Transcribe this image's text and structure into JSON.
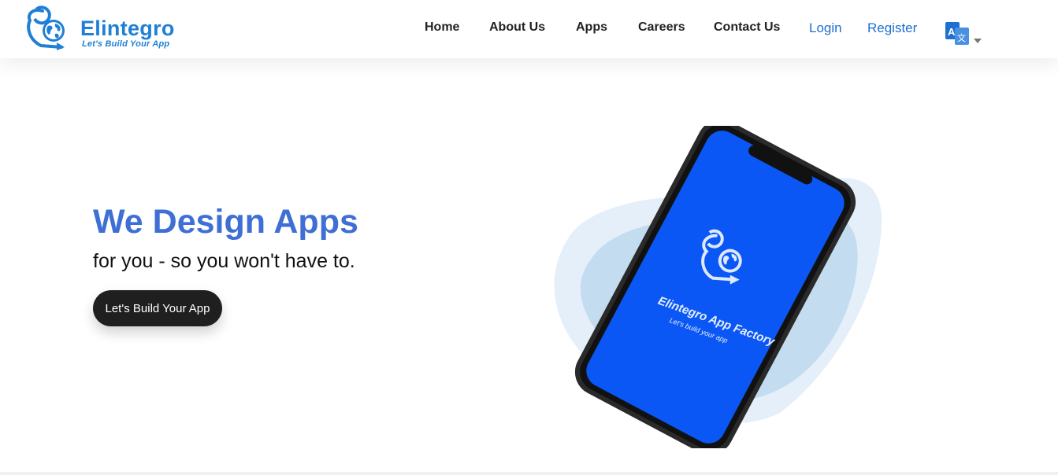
{
  "brand": {
    "name": "Elintegro",
    "tagline": "Let's Build Your App",
    "color": "#1f7fd4"
  },
  "nav": {
    "items": [
      {
        "label": "Home"
      },
      {
        "label": "About Us"
      },
      {
        "label": "Apps"
      },
      {
        "label": "Careers"
      },
      {
        "label": "Contact Us"
      }
    ],
    "login": "Login",
    "register": "Register",
    "language_icon": "translate-icon"
  },
  "hero": {
    "title": "We Design Apps",
    "subtitle": "for you - so you won't have to.",
    "cta_label": "Let's Build Your App",
    "title_color": "#3f6fd4"
  },
  "phone_screen": {
    "app_name": "Elintegro App Factory",
    "app_tagline": "Let's build your app",
    "screen_color": "#0a57f5"
  }
}
